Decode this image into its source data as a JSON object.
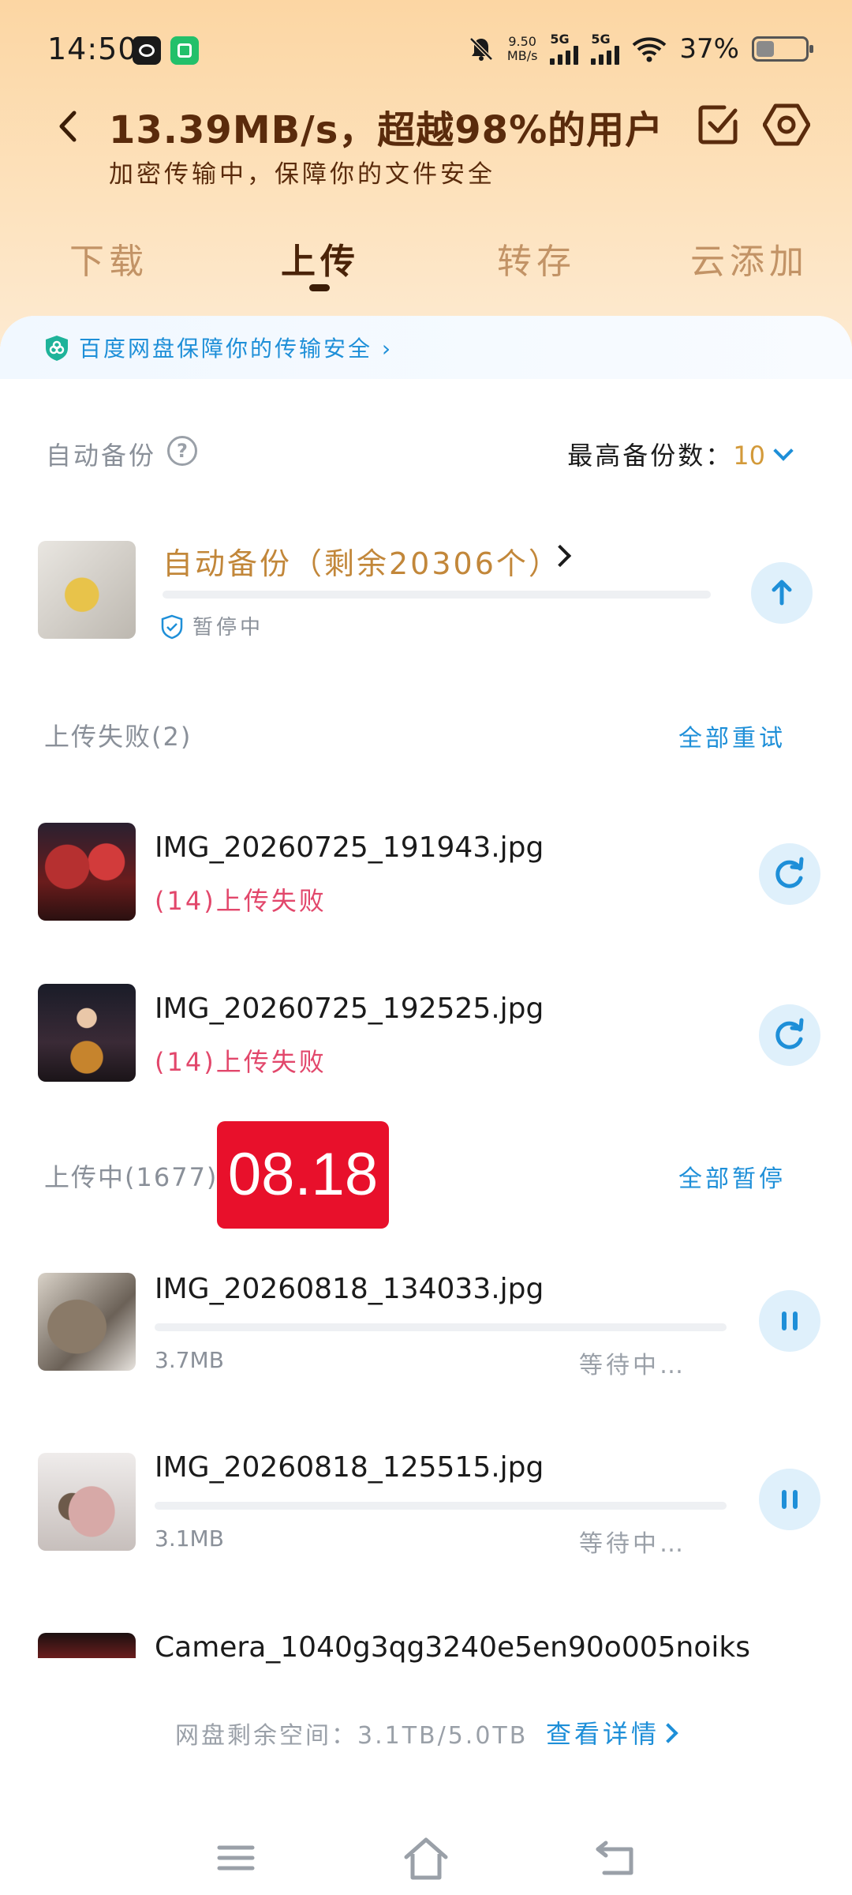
{
  "status_bar": {
    "time": "14:50",
    "net_speed_value": "9.50",
    "net_speed_unit": "MB/s",
    "sim1": "5G",
    "sim2": "5G",
    "battery_pct": "37%",
    "battery_level": 0.37
  },
  "header": {
    "headline": "13.39MB/s，超越98%的用户",
    "subline": "加密传输中，保障你的文件安全"
  },
  "tabs": [
    {
      "label": "下载",
      "active": false
    },
    {
      "label": "上传",
      "active": true
    },
    {
      "label": "转存",
      "active": false
    },
    {
      "label": "云添加",
      "active": false
    }
  ],
  "security_banner": "百度网盘保障你的传输安全",
  "auto_backup": {
    "section_label": "自动备份",
    "help_glyph": "?",
    "max_label": "最高备份数：",
    "max_value": "10",
    "row_title": "自动备份（剩余20306个）",
    "status": "暂停中",
    "progress": 0
  },
  "failed_section": {
    "label": "上传失败(2)",
    "action": "全部重试",
    "items": [
      {
        "name": "IMG_20260725_191943.jpg",
        "status": "(14)上传失败"
      },
      {
        "name": "IMG_20260725_192525.jpg",
        "status": "(14)上传失败"
      }
    ]
  },
  "uploading_section": {
    "label": "上传中(1677)",
    "action": "全部暂停",
    "date_badge": "08.18",
    "items": [
      {
        "name": "IMG_20260818_134033.jpg",
        "size": "3.7MB",
        "status": "等待中…",
        "progress": 0
      },
      {
        "name": "IMG_20260818_125515.jpg",
        "size": "3.1MB",
        "status": "等待中…",
        "progress": 0
      },
      {
        "name": "Camera_1040g3qg3240e5en90o005noiks"
      }
    ]
  },
  "footer": {
    "storage": "网盘剩余空间：3.1TB/5.0TB",
    "details": "查看详情"
  },
  "colors": {
    "accent_blue": "#1e8fd8",
    "header_brown": "#5a2b0c",
    "fail_pink": "#e2476b",
    "badge_red": "#e8102b",
    "gold": "#c2873a"
  }
}
